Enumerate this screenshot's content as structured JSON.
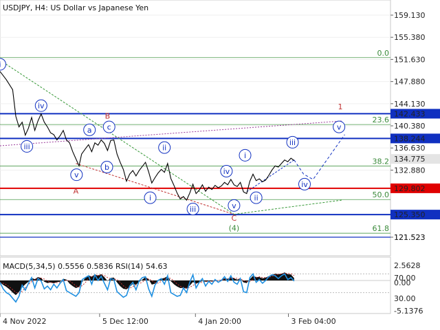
{
  "chart_data": {
    "type": "line",
    "title": "USDJPY, H4:  US Dollar vs Japanese Yen",
    "symbol": "USDJPY",
    "timeframe": "H4",
    "ylim": [
      120.5,
      161.0
    ],
    "x_range": [
      "4 Nov 2022",
      "28 Feb 2023"
    ],
    "x_ticks": [
      {
        "label": "4 Nov 2022",
        "t": 0
      },
      {
        "label": "5 Dec 12:00",
        "t": 31.5
      },
      {
        "label": "4 Jan 20:00",
        "t": 61.8
      },
      {
        "label": "3 Feb 04:00",
        "t": 91.2
      }
    ],
    "y_ticks": [
      159.13,
      155.38,
      151.63,
      147.88,
      144.13,
      140.38,
      136.63,
      132.88,
      121.523
    ],
    "price_boxes": [
      {
        "value": "142.433",
        "style": "blue"
      },
      {
        "value": "138.244",
        "style": "blue"
      },
      {
        "value": "134.775",
        "style": "current"
      },
      {
        "value": "129.802",
        "style": "red"
      },
      {
        "value": "125.350",
        "style": "blue"
      },
      {
        "value": "121.523",
        "style": "plain"
      }
    ],
    "levels": [
      {
        "value": 142.433,
        "color": "#1030c0"
      },
      {
        "value": 138.244,
        "color": "#1030c0"
      },
      {
        "value": 129.802,
        "color": "#e00000"
      },
      {
        "value": 125.35,
        "color": "#1030c0"
      },
      {
        "value": 121.523,
        "color": "#1030c0",
        "thin": true
      }
    ],
    "fib_levels": [
      {
        "label": "0.0",
        "value": 151.94
      },
      {
        "label": "23.6",
        "value": 140.6
      },
      {
        "label": "38.2",
        "value": 133.58
      },
      {
        "label": "50.0",
        "value": 127.9
      },
      {
        "label": "61.8",
        "value": 122.2
      }
    ],
    "price_series": [
      [
        0,
        149.6
      ],
      [
        2,
        148.2
      ],
      [
        4,
        146.5
      ],
      [
        5,
        142.0
      ],
      [
        6,
        140.2
      ],
      [
        7,
        141.0
      ],
      [
        8,
        138.8
      ],
      [
        9,
        140.0
      ],
      [
        10,
        141.8
      ],
      [
        11,
        139.6
      ],
      [
        12,
        141.2
      ],
      [
        13,
        142.4
      ],
      [
        14,
        141.0
      ],
      [
        15,
        140.2
      ],
      [
        16,
        139.2
      ],
      [
        17,
        138.9
      ],
      [
        18,
        138.0
      ],
      [
        19,
        138.7
      ],
      [
        20,
        139.6
      ],
      [
        21,
        138.0
      ],
      [
        22,
        137.5
      ],
      [
        23,
        136.0
      ],
      [
        24,
        134.8
      ],
      [
        25,
        133.6
      ],
      [
        25.8,
        135.6
      ],
      [
        27,
        136.5
      ],
      [
        28,
        137.2
      ],
      [
        29,
        136.0
      ],
      [
        30,
        137.5
      ],
      [
        31,
        137.1
      ],
      [
        32,
        138.0
      ],
      [
        33,
        137.4
      ],
      [
        34,
        136.2
      ],
      [
        35,
        137.9
      ],
      [
        36,
        138.0
      ],
      [
        37,
        135.6
      ],
      [
        38,
        134.2
      ],
      [
        39,
        133.0
      ],
      [
        40,
        131.0
      ],
      [
        41,
        132.2
      ],
      [
        42,
        132.8
      ],
      [
        43,
        131.9
      ],
      [
        44,
        132.8
      ],
      [
        45,
        133.5
      ],
      [
        46,
        134.2
      ],
      [
        47,
        132.6
      ],
      [
        48,
        130.7
      ],
      [
        49,
        131.6
      ],
      [
        50,
        132.4
      ],
      [
        51,
        133.0
      ],
      [
        52,
        132.5
      ],
      [
        53,
        134.0
      ],
      [
        54,
        131.5
      ],
      [
        55,
        130.3
      ],
      [
        56,
        129.0
      ],
      [
        57,
        128.0
      ],
      [
        58,
        128.4
      ],
      [
        59,
        127.8
      ],
      [
        60,
        129.0
      ],
      [
        61,
        130.5
      ],
      [
        62,
        128.9
      ],
      [
        63,
        129.5
      ],
      [
        64,
        130.4
      ],
      [
        65,
        129.3
      ],
      [
        66,
        130.0
      ],
      [
        67,
        129.6
      ],
      [
        68,
        130.3
      ],
      [
        69,
        129.9
      ],
      [
        70,
        130.2
      ],
      [
        71,
        130.8
      ],
      [
        72,
        130.4
      ],
      [
        73,
        131.3
      ],
      [
        74,
        130.4
      ],
      [
        75,
        130.1
      ],
      [
        76,
        130.8
      ],
      [
        77,
        129.2
      ],
      [
        78,
        128.9
      ],
      [
        79,
        131.0
      ],
      [
        80,
        132.2
      ],
      [
        81,
        131.1
      ],
      [
        82,
        131.4
      ],
      [
        83,
        130.9
      ],
      [
        84,
        131.2
      ],
      [
        85,
        132.0
      ],
      [
        86,
        132.9
      ],
      [
        87,
        133.6
      ],
      [
        88,
        133.4
      ],
      [
        89,
        134.0
      ],
      [
        90,
        134.6
      ],
      [
        91,
        134.3
      ],
      [
        92,
        134.9
      ],
      [
        93,
        134.5
      ]
    ],
    "forecast_path": [
      [
        93,
        134.6
      ],
      [
        96,
        132.2
      ],
      [
        99,
        131.3
      ],
      [
        109,
        138.9
      ]
    ],
    "wave_labels": [
      {
        "text": "i",
        "t": 0,
        "y": 150.8,
        "style": "circle"
      },
      {
        "text": "iv",
        "t": 13,
        "y": 143.8,
        "style": "circle"
      },
      {
        "text": "iii",
        "t": 8.5,
        "y": 136.9,
        "style": "circle"
      },
      {
        "text": "v",
        "t": 24.2,
        "y": 132.1,
        "style": "circle"
      },
      {
        "text": "A",
        "t": 24.0,
        "y": 129.4,
        "style": "red"
      },
      {
        "text": "a",
        "t": 28.3,
        "y": 139.7,
        "style": "circle"
      },
      {
        "text": "B",
        "t": 34.0,
        "y": 142.1,
        "style": "red"
      },
      {
        "text": "c",
        "t": 34.5,
        "y": 140.2,
        "style": "circle"
      },
      {
        "text": "b",
        "t": 33.8,
        "y": 133.4,
        "style": "circle"
      },
      {
        "text": "ii",
        "t": 52.0,
        "y": 136.7,
        "style": "circle"
      },
      {
        "text": "i",
        "t": 47.5,
        "y": 128.2,
        "style": "circle"
      },
      {
        "text": "iii",
        "t": 61.0,
        "y": 126.3,
        "style": "circle"
      },
      {
        "text": "iv",
        "t": 71.6,
        "y": 132.7,
        "style": "circle"
      },
      {
        "text": "v",
        "t": 74.0,
        "y": 126.9,
        "style": "circle"
      },
      {
        "text": "C",
        "t": 74.0,
        "y": 124.8,
        "style": "red"
      },
      {
        "text": "(4)",
        "t": 74.0,
        "y": 123.1,
        "style": "green"
      },
      {
        "text": "i",
        "t": 77.5,
        "y": 135.4,
        "style": "circle"
      },
      {
        "text": "ii",
        "t": 81.0,
        "y": 128.2,
        "style": "circle"
      },
      {
        "text": "iii",
        "t": 92.5,
        "y": 137.6,
        "style": "circle"
      },
      {
        "text": "iv",
        "t": 96.3,
        "y": 130.5,
        "style": "circle"
      },
      {
        "text": "v",
        "t": 107.2,
        "y": 140.2,
        "style": "circle"
      },
      {
        "text": "1",
        "t": 107.6,
        "y": 143.9,
        "style": "red-large"
      }
    ],
    "guides": [
      {
        "from": [
          0,
          151.5
        ],
        "to": [
          74,
          125.4
        ],
        "color": "#3a9a3a",
        "dash": "3,2"
      },
      {
        "from": [
          0,
          137.0
        ],
        "to": [
          108,
          141.2
        ],
        "color": "#9a3a9a",
        "dash": "2,2"
      },
      {
        "from": [
          24,
          134.0
        ],
        "to": [
          74,
          125.4
        ],
        "color": "#c03030",
        "dash": "3,2"
      },
      {
        "from": [
          74,
          125.4
        ],
        "to": [
          108,
          127.8
        ],
        "color": "#3a9a3a",
        "dash": "3,2"
      },
      {
        "from": [
          78,
          129.2
        ],
        "to": [
          93,
          134.6
        ],
        "color": "#1030c0",
        "dash": "3,2"
      }
    ],
    "indicator": {
      "title": "MACD(5,34,5) 0.5556 0.5836 RSI(14) 54.63",
      "macd_params": "MACD(5,34,5)",
      "macd_value": 0.5556,
      "signal_value": 0.5836,
      "rsi_params": "RSI(14)",
      "rsi_value": 54.63,
      "ticks": [
        "2.5628",
        "70.00",
        "0.00",
        "30.00",
        "-5.1376"
      ],
      "macd_hist": [
        [
          0,
          -0.6
        ],
        [
          1,
          -1.4
        ],
        [
          2,
          -2.0
        ],
        [
          3,
          -2.8
        ],
        [
          4,
          -3.8
        ],
        [
          5,
          -4.6
        ],
        [
          6,
          -3.6
        ],
        [
          7,
          -2.2
        ],
        [
          8,
          -1.2
        ],
        [
          9,
          -0.4
        ],
        [
          10,
          0.6
        ],
        [
          11,
          0.3
        ],
        [
          12,
          0.8
        ],
        [
          13,
          0.6
        ],
        [
          14,
          -0.4
        ],
        [
          15,
          -0.8
        ],
        [
          16,
          -0.6
        ],
        [
          17,
          -0.9
        ],
        [
          18,
          -0.5
        ],
        [
          19,
          -0.4
        ],
        [
          20,
          0.4
        ],
        [
          21,
          0.2
        ],
        [
          22,
          -1.0
        ],
        [
          23,
          -1.8
        ],
        [
          24,
          -2.4
        ],
        [
          25,
          -2.0
        ],
        [
          26,
          -0.5
        ],
        [
          27,
          0.6
        ],
        [
          28,
          1.2
        ],
        [
          29,
          0.9
        ],
        [
          30,
          1.4
        ],
        [
          31,
          1.2
        ],
        [
          32,
          1.5
        ],
        [
          33,
          0.8
        ],
        [
          34,
          -0.2
        ],
        [
          35,
          0.6
        ],
        [
          36,
          0.7
        ],
        [
          37,
          -0.6
        ],
        [
          38,
          -1.8
        ],
        [
          39,
          -2.6
        ],
        [
          40,
          -2.8
        ],
        [
          41,
          -2.0
        ],
        [
          42,
          -1.1
        ],
        [
          43,
          -1.3
        ],
        [
          44,
          -0.5
        ],
        [
          45,
          0.2
        ],
        [
          46,
          0.8
        ],
        [
          47,
          0.3
        ],
        [
          48,
          -1.3
        ],
        [
          49,
          -1.0
        ],
        [
          50,
          -0.2
        ],
        [
          51,
          0.4
        ],
        [
          52,
          0.6
        ],
        [
          53,
          1.0
        ],
        [
          54,
          -0.2
        ],
        [
          55,
          -1.2
        ],
        [
          56,
          -1.9
        ],
        [
          57,
          -2.4
        ],
        [
          58,
          -2.3
        ],
        [
          59,
          -2.6
        ],
        [
          60,
          -1.6
        ],
        [
          61,
          -0.5
        ],
        [
          62,
          -0.9
        ],
        [
          63,
          -0.7
        ],
        [
          64,
          -0.1
        ],
        [
          65,
          -0.4
        ],
        [
          66,
          -0.2
        ],
        [
          67,
          -0.3
        ],
        [
          68,
          0.1
        ],
        [
          69,
          0.0
        ],
        [
          70,
          0.2
        ],
        [
          71,
          0.5
        ],
        [
          72,
          0.4
        ],
        [
          73,
          0.8
        ],
        [
          74,
          0.5
        ],
        [
          75,
          0.2
        ],
        [
          76,
          0.4
        ],
        [
          77,
          -0.6
        ],
        [
          78,
          -0.8
        ],
        [
          79,
          0.3
        ],
        [
          80,
          1.1
        ],
        [
          81,
          0.8
        ],
        [
          82,
          0.8
        ],
        [
          83,
          0.5
        ],
        [
          84,
          0.7
        ],
        [
          85,
          1.0
        ],
        [
          86,
          1.3
        ],
        [
          87,
          1.6
        ],
        [
          88,
          1.5
        ],
        [
          89,
          1.6
        ],
        [
          90,
          1.9
        ],
        [
          91,
          1.5
        ],
        [
          92,
          1.4
        ],
        [
          93,
          0.56
        ]
      ],
      "rsi": [
        [
          0,
          52
        ],
        [
          1,
          38
        ],
        [
          2,
          30
        ],
        [
          3,
          26
        ],
        [
          4,
          18
        ],
        [
          5,
          10
        ],
        [
          6,
          22
        ],
        [
          7,
          46
        ],
        [
          8,
          35
        ],
        [
          9,
          50
        ],
        [
          10,
          62
        ],
        [
          11,
          40
        ],
        [
          12,
          60
        ],
        [
          13,
          55
        ],
        [
          14,
          38
        ],
        [
          15,
          44
        ],
        [
          16,
          36
        ],
        [
          17,
          48
        ],
        [
          18,
          40
        ],
        [
          19,
          50
        ],
        [
          20,
          58
        ],
        [
          21,
          34
        ],
        [
          22,
          30
        ],
        [
          23,
          26
        ],
        [
          24,
          22
        ],
        [
          25,
          30
        ],
        [
          26,
          58
        ],
        [
          27,
          62
        ],
        [
          28,
          66
        ],
        [
          29,
          48
        ],
        [
          30,
          68
        ],
        [
          31,
          56
        ],
        [
          32,
          65
        ],
        [
          33,
          50
        ],
        [
          34,
          36
        ],
        [
          35,
          60
        ],
        [
          36,
          58
        ],
        [
          37,
          32
        ],
        [
          38,
          26
        ],
        [
          39,
          20
        ],
        [
          40,
          24
        ],
        [
          41,
          44
        ],
        [
          42,
          52
        ],
        [
          43,
          36
        ],
        [
          44,
          55
        ],
        [
          45,
          62
        ],
        [
          46,
          64
        ],
        [
          47,
          38
        ],
        [
          48,
          22
        ],
        [
          49,
          46
        ],
        [
          50,
          56
        ],
        [
          51,
          60
        ],
        [
          52,
          48
        ],
        [
          53,
          66
        ],
        [
          54,
          30
        ],
        [
          55,
          26
        ],
        [
          56,
          22
        ],
        [
          57,
          24
        ],
        [
          58,
          40
        ],
        [
          59,
          30
        ],
        [
          60,
          52
        ],
        [
          61,
          68
        ],
        [
          62,
          40
        ],
        [
          63,
          52
        ],
        [
          64,
          60
        ],
        [
          65,
          44
        ],
        [
          66,
          54
        ],
        [
          67,
          48
        ],
        [
          68,
          58
        ],
        [
          69,
          52
        ],
        [
          70,
          56
        ],
        [
          71,
          64
        ],
        [
          72,
          54
        ],
        [
          73,
          66
        ],
        [
          74,
          52
        ],
        [
          75,
          48
        ],
        [
          76,
          60
        ],
        [
          77,
          32
        ],
        [
          78,
          30
        ],
        [
          79,
          62
        ],
        [
          80,
          70
        ],
        [
          81,
          52
        ],
        [
          82,
          58
        ],
        [
          83,
          50
        ],
        [
          84,
          56
        ],
        [
          85,
          64
        ],
        [
          86,
          68
        ],
        [
          87,
          66
        ],
        [
          88,
          60
        ],
        [
          89,
          66
        ],
        [
          90,
          70
        ],
        [
          91,
          58
        ],
        [
          92,
          62
        ],
        [
          93,
          54.6
        ]
      ]
    }
  }
}
